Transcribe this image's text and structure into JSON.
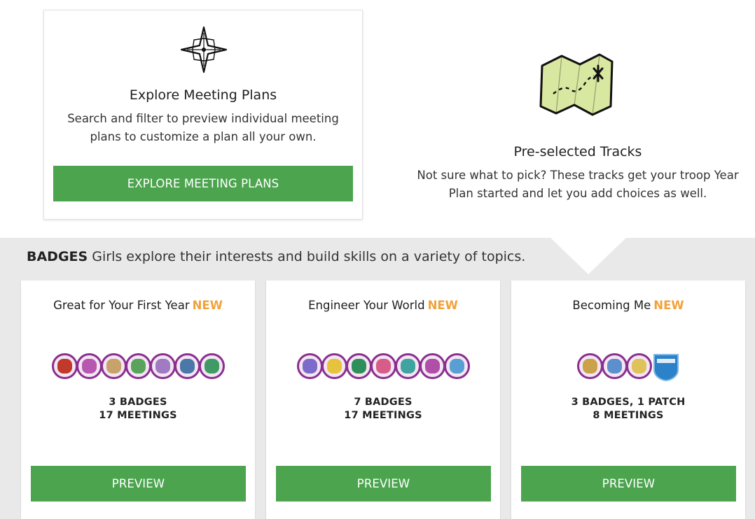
{
  "explore": {
    "icon": "compass-star-icon",
    "title": "Explore Meeting Plans",
    "desc_line1": "Search and filter to preview individual meeting",
    "desc_line2": "plans to customize a plan all your own.",
    "button_label": "EXPLORE MEETING PLANS"
  },
  "tracks": {
    "icon": "treasure-map-icon",
    "title": "Pre-selected Tracks",
    "desc_line1": "Not sure what to pick? These tracks get your troop Year",
    "desc_line2": "Plan started and let you add choices as well."
  },
  "badges": {
    "label": "BADGES",
    "desc": "Girls explore their interests and build skills on a variety of topics."
  },
  "new_tag": "NEW",
  "cards": [
    {
      "title": "Great for Your First Year",
      "stats_line1": "3 BADGES",
      "stats_line2": "17 MEETINGS",
      "button_label": "PREVIEW",
      "badge_colors": [
        "#c0392b",
        "#b857b0",
        "#c7a36b",
        "#5aa35a",
        "#a07ac2",
        "#4b78a8",
        "#3f9a66"
      ]
    },
    {
      "title": "Engineer Your World",
      "stats_line1": "7 BADGES",
      "stats_line2": "17 MEETINGS",
      "button_label": "PREVIEW",
      "badge_colors": [
        "#7d6bc9",
        "#e6c33c",
        "#2f8f5a",
        "#d85c8a",
        "#3fa4a0",
        "#b04ea8",
        "#5a9fd4"
      ]
    },
    {
      "title": "Becoming Me",
      "stats_line1": "3 BADGES, 1 PATCH",
      "stats_line2": "8 MEETINGS",
      "button_label": "PREVIEW",
      "badge_colors": [
        "#c9a24a",
        "#5d8fcf",
        "#e0c25a"
      ],
      "patch_color": "#2b82c9"
    }
  ],
  "accent": "#4ca44e",
  "new_color": "#f2a23a"
}
